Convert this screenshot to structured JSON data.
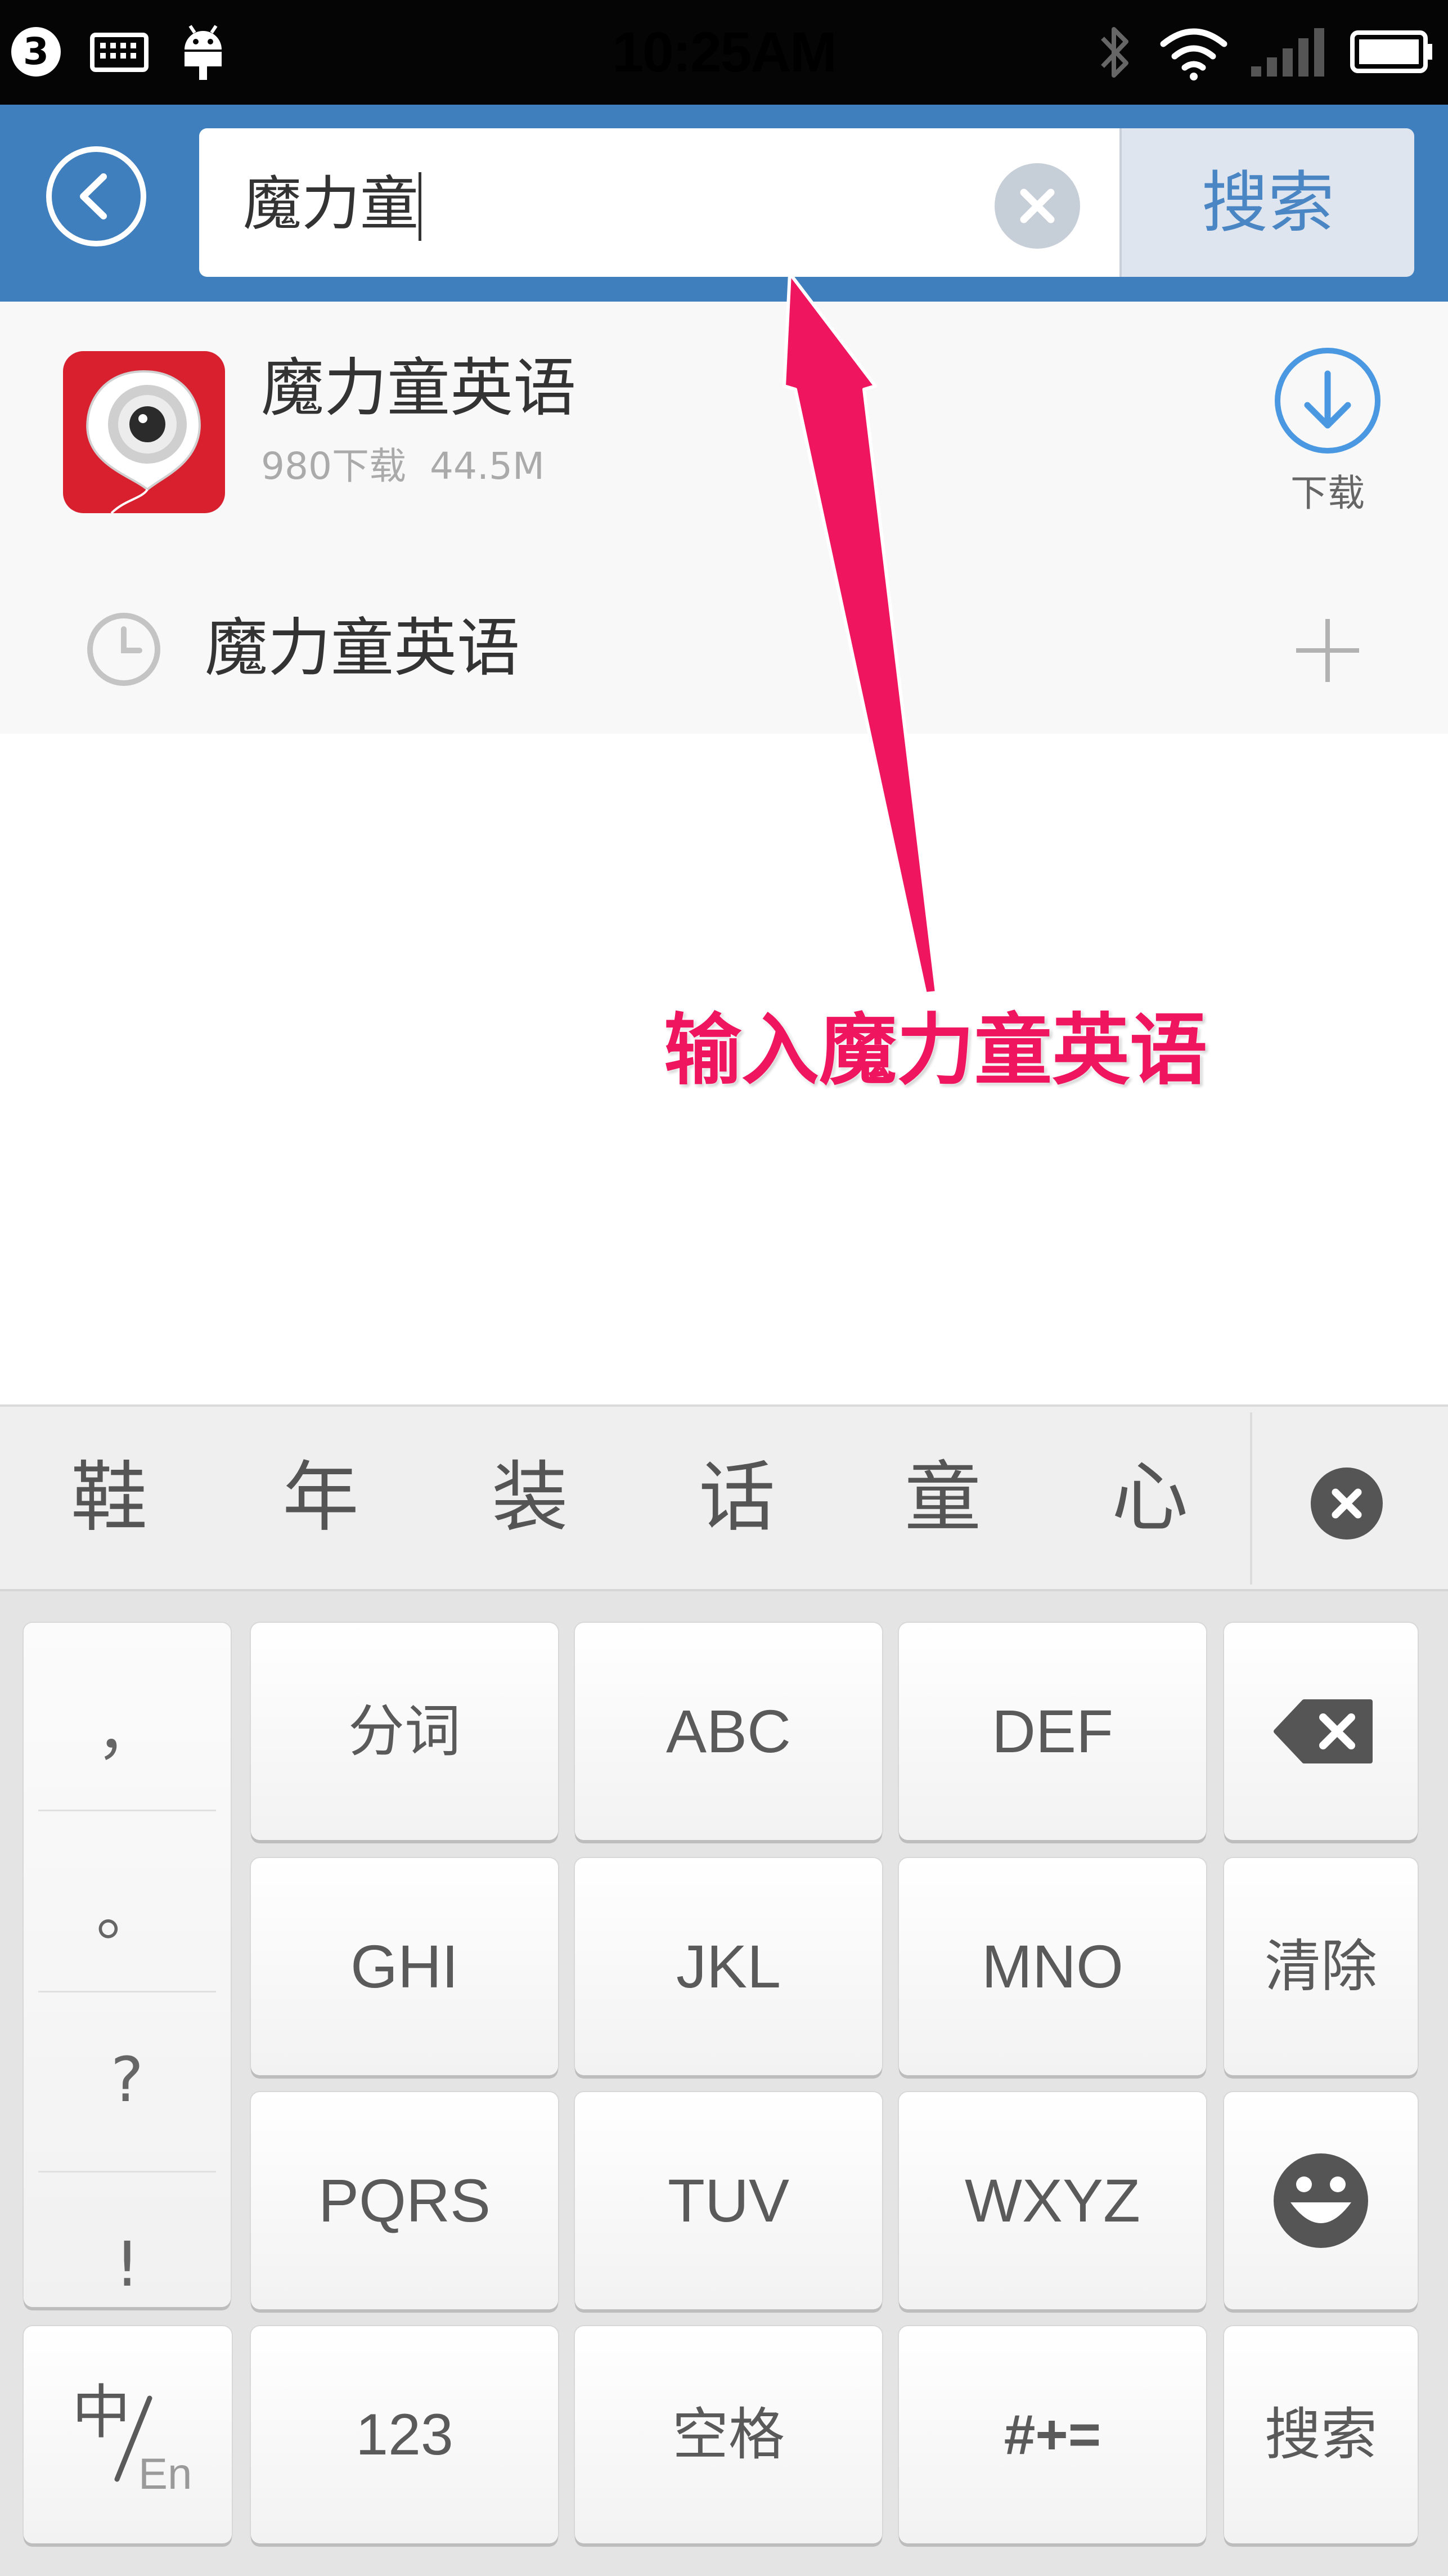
{
  "status_bar": {
    "notification_count": "3",
    "time": "10:25AM",
    "icons": [
      "keyboard-icon",
      "android-icon",
      "bluetooth-icon",
      "wifi-icon",
      "signal-icon",
      "battery-icon"
    ]
  },
  "search": {
    "query": "魔力童",
    "button_label": "搜索"
  },
  "result": {
    "app_name": "魔力童英语",
    "downloads": "980下载",
    "size": "44.5M",
    "download_label": "下载"
  },
  "history": {
    "text": "魔力童英语"
  },
  "annotation": "输入魔力童英语",
  "candidates": [
    "鞋",
    "年",
    "装",
    "话",
    "童",
    "心"
  ],
  "keyboard": {
    "symbols": [
      "，",
      "。",
      "?",
      "!"
    ],
    "rows": [
      [
        "分词",
        "ABC",
        "DEF"
      ],
      [
        "GHI",
        "JKL",
        "MNO"
      ],
      [
        "PQRS",
        "TUV",
        "WXYZ"
      ]
    ],
    "clear_label": "清除",
    "lang_top": "中",
    "lang_bottom": "En",
    "num_label": "123",
    "space_label": "空格",
    "sym_label": "#+=",
    "search_label": "搜索"
  },
  "colors": {
    "header": "#3f7fbd",
    "accent_blue": "#4a98e2",
    "annotation": "#f0155f",
    "app_icon": "#d8202f"
  }
}
